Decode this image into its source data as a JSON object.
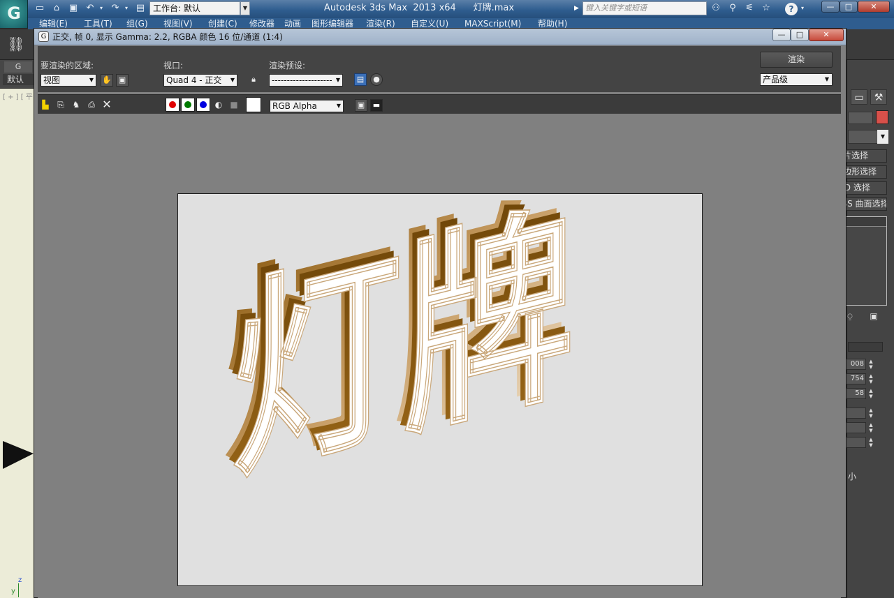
{
  "app": {
    "logo_glyph": "G",
    "title": "Autodesk 3ds Max  2013 x64      灯牌.max",
    "workspace_value": "工作台: 默认",
    "search_placeholder": "键入关键字或短语",
    "help_label": "?",
    "window_buttons": [
      "—",
      "□",
      "✕"
    ]
  },
  "menu": [
    "编辑(E)",
    "工具(T)",
    "组(G)",
    "视图(V)",
    "创建(C)",
    "修改器",
    "动画",
    "图形编辑器",
    "渲染(R)",
    "自定义(U)",
    "MAXScript(M)",
    "帮助(H)"
  ],
  "left": {
    "tab": "G",
    "default_label": "默认",
    "viewport_label": "[ + ] [ 平",
    "axis_z": "z",
    "axis_y": "y"
  },
  "command_panel": {
    "buttons": [
      "面片选择",
      "多边形选择",
      "FFD 选择",
      "NURBS 曲面选择"
    ],
    "spinners": [
      "008",
      "754",
      "58",
      "",
      "",
      ""
    ],
    "small_label": "小"
  },
  "render_window": {
    "logo_glyph": "G",
    "title": "正交, 帧 0, 显示 Gamma: 2.2, RGBA 颜色 16 位/通道 (1:4)",
    "area_label": "要渲染的区域:",
    "area_value": "视图",
    "viewport_label": "视口:",
    "viewport_value": "Quad 4 - 正交",
    "preset_label": "渲染预设:",
    "preset_value": "--------------------",
    "render_button": "渲染",
    "quality_value": "产品级",
    "channel_value": "RGB Alpha",
    "channel_colors": {
      "red": "#e00000",
      "green": "#007a00",
      "blue": "#0000e0"
    },
    "rendered_text": "灯牌"
  }
}
